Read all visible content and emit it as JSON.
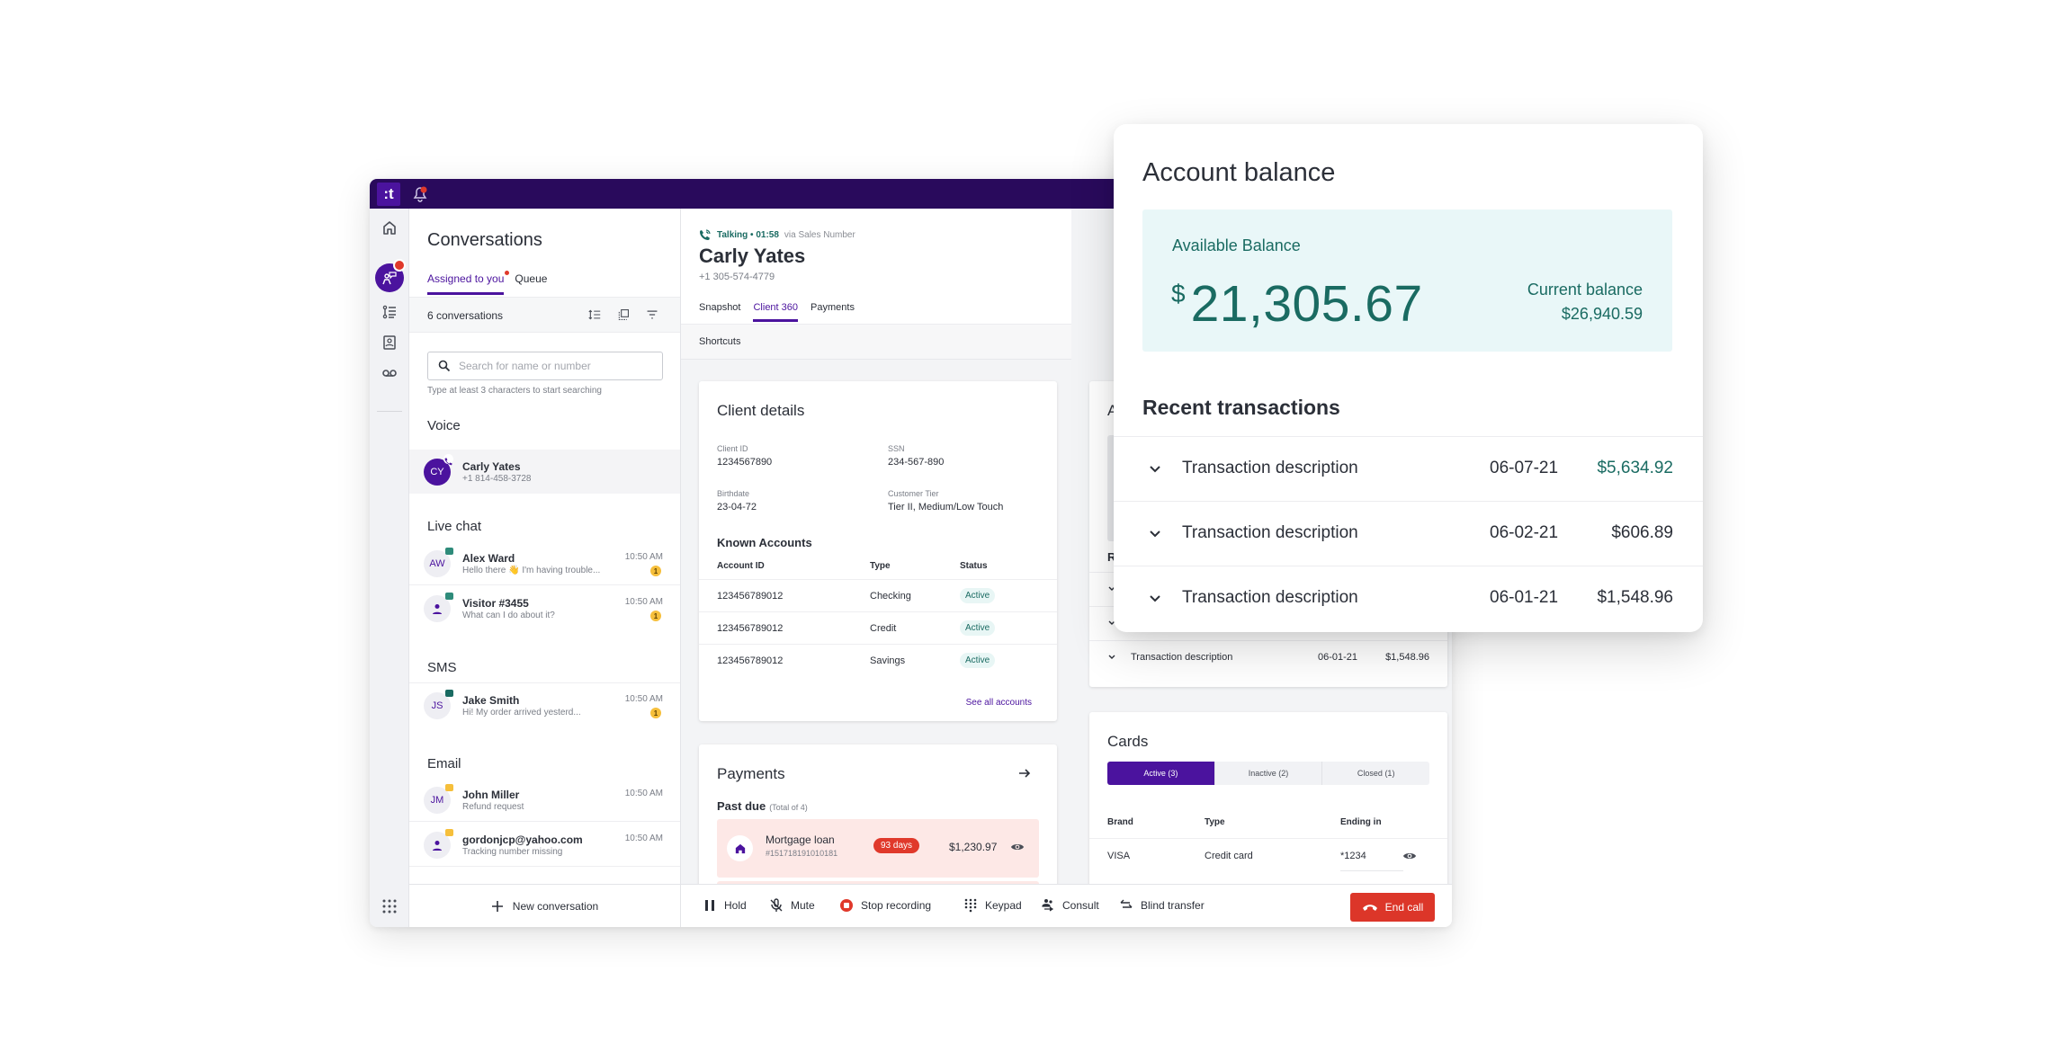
{
  "app": {
    "logo_text": ":t",
    "accent_color": "#4b139e",
    "topbar_color": "#290a5c",
    "danger_color": "#dc3629",
    "success_color": "#1a6b62"
  },
  "rail": {
    "items": [
      {
        "name": "home",
        "icon": "home-icon"
      },
      {
        "name": "conversations",
        "icon": "agent-chat-icon",
        "active": true,
        "badge": true
      },
      {
        "name": "tasks",
        "icon": "task-list-icon"
      },
      {
        "name": "contacts",
        "icon": "contact-book-icon"
      },
      {
        "name": "voicemail",
        "icon": "voicemail-icon"
      }
    ],
    "apps_icon": "apps-grid-icon"
  },
  "conversations": {
    "title": "Conversations",
    "tabs": [
      {
        "label": "Assigned to you",
        "active": true,
        "has_dot": true
      },
      {
        "label": "Queue",
        "active": false
      }
    ],
    "count_label": "6 conversations",
    "search": {
      "placeholder": "Search for name or number",
      "value": "",
      "hint": "Type at least 3 characters to start searching"
    },
    "sections": [
      {
        "title": "Voice",
        "items": [
          {
            "initials": "CY",
            "name": "Carly Yates",
            "sub": "+1 814-458-3728",
            "time": "",
            "unread": "",
            "selected": true
          }
        ]
      },
      {
        "title": "Live chat",
        "items": [
          {
            "initials": "AW",
            "name": "Alex Ward",
            "sub": "Hello there 👋 I'm having trouble...",
            "time": "10:50 AM",
            "unread": "1"
          },
          {
            "initials": "",
            "name": "Visitor #3455",
            "sub": "What can I do about it?",
            "time": "10:50 AM",
            "unread": "1"
          }
        ]
      },
      {
        "title": "SMS",
        "items": [
          {
            "initials": "JS",
            "name": "Jake Smith",
            "sub": "Hi! My order arrived yesterd...",
            "time": "10:50 AM",
            "unread": "1"
          }
        ]
      },
      {
        "title": "Email",
        "items": [
          {
            "initials": "JM",
            "name": "John Miller",
            "sub": "Refund request",
            "time": "10:50 AM",
            "unread": ""
          },
          {
            "initials": "",
            "name": "gordonjcp@yahoo.com",
            "sub": "Tracking number missing",
            "time": "10:50 AM",
            "unread": ""
          }
        ]
      }
    ],
    "new_conversation_label": "New conversation"
  },
  "call": {
    "status": "Talking • 01:58",
    "via": "via Sales Number",
    "caller_name": "Carly Yates",
    "caller_phone": "+1 305-574-4779",
    "tabs": [
      {
        "label": "Snapshot",
        "active": false
      },
      {
        "label": "Client 360",
        "active": true
      },
      {
        "label": "Payments",
        "active": false
      }
    ],
    "shortcuts_label": "Shortcuts"
  },
  "client_details": {
    "title": "Client details",
    "fields": [
      {
        "label": "Client ID",
        "value": "1234567890"
      },
      {
        "label": "SSN",
        "value": "234-567-890"
      },
      {
        "label": "Birthdate",
        "value": "23-04-72"
      },
      {
        "label": "Customer Tier",
        "value": "Tier II, Medium/Low Touch"
      }
    ],
    "known_accounts_title": "Known Accounts",
    "columns": [
      "Account ID",
      "Type",
      "Status"
    ],
    "accounts": [
      {
        "id": "123456789012",
        "type": "Checking",
        "status": "Active"
      },
      {
        "id": "123456789012",
        "type": "Credit",
        "status": "Active"
      },
      {
        "id": "123456789012",
        "type": "Savings",
        "status": "Active"
      }
    ],
    "see_all_label": "See all accounts"
  },
  "payments": {
    "title": "Payments",
    "past_due_label": "Past due",
    "past_due_total": "(Total of 4)",
    "items": [
      {
        "name": "Mortgage loan",
        "number": "#151718191010181",
        "days": "93 days",
        "amount": "$1,230.97"
      }
    ]
  },
  "account_behind": {
    "title_fragment": "Ac",
    "recent_fragment": "Rec",
    "transactions": [
      {
        "description": "",
        "date": "",
        "amount": ""
      },
      {
        "description": "",
        "date": "",
        "amount": ""
      },
      {
        "description": "Transaction description",
        "date": "06-01-21",
        "amount": "$1,548.96"
      }
    ]
  },
  "cards": {
    "title": "Cards",
    "segments": [
      {
        "label": "Active (3)",
        "active": true
      },
      {
        "label": "Inactive (2)",
        "active": false
      },
      {
        "label": "Closed (1)",
        "active": false
      }
    ],
    "columns": [
      "Brand",
      "Type",
      "Ending in"
    ],
    "rows": [
      {
        "brand": "VISA",
        "type": "Credit card",
        "ending": "*1234"
      }
    ]
  },
  "call_controls": {
    "hold": "Hold",
    "mute": "Mute",
    "stop_recording": "Stop recording",
    "keypad": "Keypad",
    "consult": "Consult",
    "blind_transfer": "Blind transfer",
    "end_call": "End call"
  },
  "account_balance": {
    "title": "Account balance",
    "available_label": "Available Balance",
    "currency_symbol": "$",
    "available_amount": "21,305.67",
    "current_label": "Current balance",
    "current_amount": "$26,940.59",
    "recent_title": "Recent transactions",
    "transactions": [
      {
        "description": "Transaction description",
        "date": "06-07-21",
        "amount": "$5,634.92",
        "credit": true
      },
      {
        "description": "Transaction description",
        "date": "06-02-21",
        "amount": "$606.89",
        "credit": false
      },
      {
        "description": "Transaction description",
        "date": "06-01-21",
        "amount": "$1,548.96",
        "credit": false
      }
    ]
  }
}
